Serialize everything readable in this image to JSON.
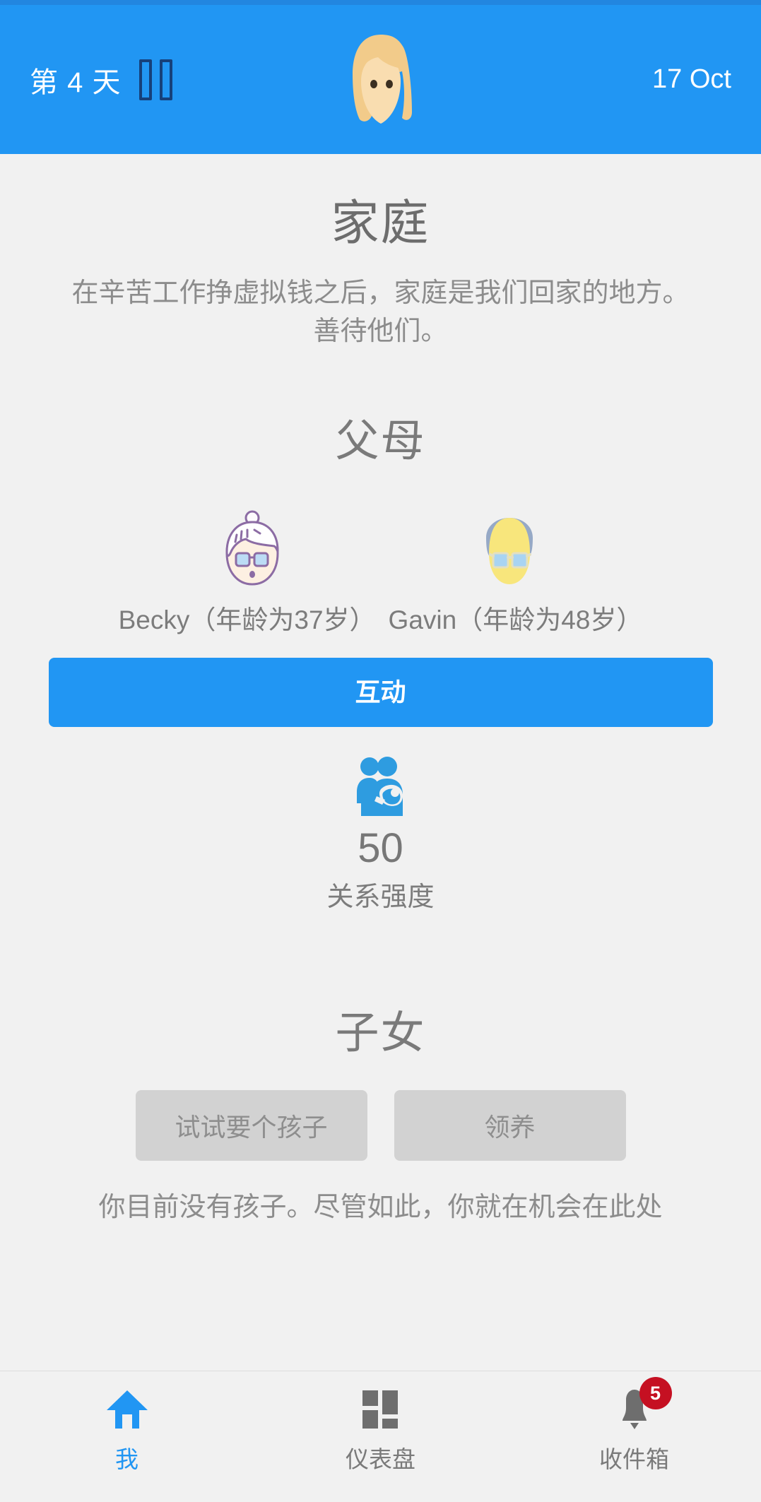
{
  "theme": {
    "accent": "#2196f3",
    "page_bg": "#f1f1f1",
    "badge_red": "#c51022",
    "muted_text": "#8c8c8c",
    "secondary_button_bg": "#d2d2d2"
  },
  "header": {
    "day_label": "第 4 天",
    "pause_icon": "pause-icon",
    "avatar_icon": "female-avatar-icon",
    "date": "17 Oct"
  },
  "page": {
    "title": "家庭",
    "subtitle": "在辛苦工作挣虚拟钱之后，家庭是我们回家的地方。善待他们。"
  },
  "parents": {
    "section_title": "父母",
    "people": [
      {
        "name": "Becky",
        "age_text": "（年龄为37岁）",
        "label": "Becky（年龄为37岁）",
        "avatar_icon": "grandmother-face-icon"
      },
      {
        "name": "Gavin",
        "age_text": "（年龄为48岁）",
        "label": "Gavin（年龄为48岁）",
        "avatar_icon": "grandfather-face-icon"
      }
    ],
    "interact_button": "互动",
    "stat": {
      "icon": "family-with-baby-icon",
      "value": "50",
      "label": "关系强度"
    }
  },
  "children": {
    "section_title": "子女",
    "buttons": [
      {
        "label": "试试要个孩子",
        "name": "try-for-baby-button"
      },
      {
        "label": "领养",
        "name": "adopt-button"
      }
    ],
    "note": "你目前没有孩子。尽管如此，你就在机会在此处"
  },
  "bottom_nav": {
    "items": [
      {
        "label": "我",
        "icon": "home-icon",
        "active": true,
        "badge": ""
      },
      {
        "label": "仪表盘",
        "icon": "dashboard-grid-icon",
        "active": false,
        "badge": ""
      },
      {
        "label": "收件箱",
        "icon": "bell-icon",
        "active": false,
        "badge": "5"
      }
    ]
  }
}
